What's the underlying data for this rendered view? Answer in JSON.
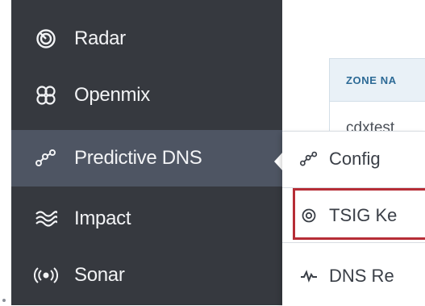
{
  "sidebar": {
    "items": [
      {
        "label": "Radar",
        "icon": "radar-icon",
        "active": false
      },
      {
        "label": "Openmix",
        "icon": "openmix-icon",
        "active": false
      },
      {
        "label": "Predictive DNS",
        "icon": "predictive-dns-icon",
        "active": true
      },
      {
        "label": "Impact",
        "icon": "impact-icon",
        "active": false
      },
      {
        "label": "Sonar",
        "icon": "sonar-icon",
        "active": false
      }
    ]
  },
  "main": {
    "table": {
      "header": "ZONE NA",
      "first_cell": "cdxtest"
    }
  },
  "popup": {
    "items": [
      {
        "label": "Config",
        "icon": "config-icon"
      },
      {
        "label": "TSIG Ke",
        "icon": "tsig-key-icon"
      },
      {
        "label": "DNS Re",
        "icon": "dns-report-icon"
      }
    ]
  },
  "colors": {
    "sidebar_bg": "#36393f",
    "sidebar_active_bg": "#4e5563",
    "highlight_border": "#b62d36",
    "table_header_text": "#2c6a96"
  }
}
